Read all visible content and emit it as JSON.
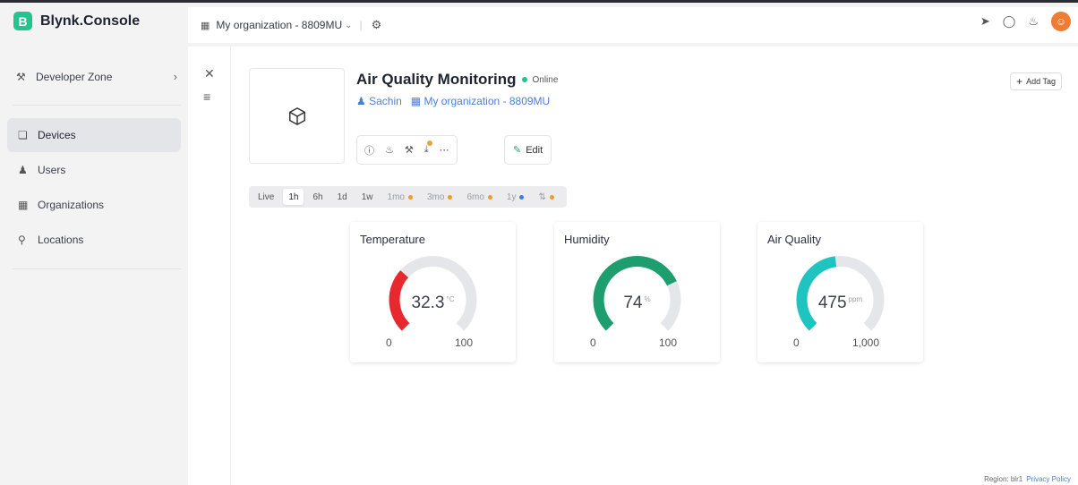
{
  "app": {
    "logo_letter": "B",
    "name": "Blynk.Console"
  },
  "topbar": {
    "org_name": "My organization - 8809MU"
  },
  "sidebar": {
    "developer_zone": "Developer Zone",
    "items": [
      {
        "label": "Devices",
        "icon": "cube-icon",
        "active": true
      },
      {
        "label": "Users",
        "icon": "users-icon",
        "active": false
      },
      {
        "label": "Organizations",
        "icon": "building-icon",
        "active": false
      },
      {
        "label": "Locations",
        "icon": "pin-icon",
        "active": false
      }
    ]
  },
  "device": {
    "name": "Air Quality Monitoring",
    "status": "Online",
    "owner": "Sachin",
    "organization": "My organization - 8809MU",
    "edit_label": "Edit",
    "add_tag_label": "Add Tag"
  },
  "time_ranges": [
    {
      "label": "Live"
    },
    {
      "label": "1h",
      "active": true
    },
    {
      "label": "6h"
    },
    {
      "label": "1d"
    },
    {
      "label": "1w"
    },
    {
      "label": "1mo",
      "dot": "orange"
    },
    {
      "label": "3mo",
      "dot": "orange"
    },
    {
      "label": "6mo",
      "dot": "orange"
    },
    {
      "label": "1y",
      "dot": "blue"
    }
  ],
  "gauges": [
    {
      "title": "Temperature",
      "value": "32.3",
      "unit": "°C",
      "min": "0",
      "max": "100",
      "fraction": 0.323,
      "color": "#e8282f"
    },
    {
      "title": "Humidity",
      "value": "74",
      "unit": "%",
      "min": "0",
      "max": "100",
      "fraction": 0.74,
      "color": "#1e9e6e"
    },
    {
      "title": "Air Quality",
      "value": "475",
      "unit": "ppm",
      "min": "0",
      "max": "1,000",
      "fraction": 0.475,
      "color": "#1fc4c1"
    }
  ],
  "footer": {
    "region": "Region: blr1",
    "privacy": "Privacy Policy"
  }
}
